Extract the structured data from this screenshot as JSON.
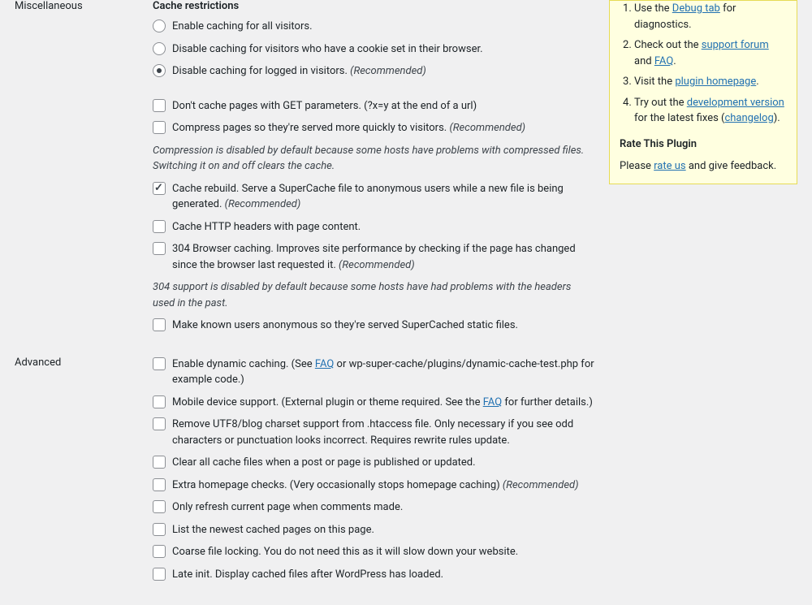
{
  "sections": {
    "misc": {
      "label": "Miscellaneous",
      "heading": "Cache restrictions",
      "radio1": "Enable caching for all visitors.",
      "radio2": "Disable caching for visitors who have a cookie set in their browser.",
      "radio3": "Disable caching for logged in visitors.",
      "recommended": "(Recommended)",
      "cb_get": "Don't cache pages with GET parameters. (?x=y at the end of a url)",
      "cb_compress": "Compress pages so they're served more quickly to visitors.",
      "note_compress": "Compression is disabled by default because some hosts have problems with compressed files. Switching it on and off clears the cache.",
      "cb_rebuild": "Cache rebuild. Serve a SuperCache file to anonymous users while a new file is being generated.",
      "cb_headers": "Cache HTTP headers with page content.",
      "cb_304": "304 Browser caching. Improves site performance by checking if the page has changed since the browser last requested it.",
      "note_304": "304 support is disabled by default because some hosts have had problems with the headers used in the past.",
      "cb_anon": "Make known users anonymous so they're served SuperCached static files."
    },
    "advanced": {
      "label": "Advanced",
      "cb_dynamic_pre": "Enable dynamic caching. (See ",
      "cb_dynamic_link": "FAQ",
      "cb_dynamic_post": " or wp-super-cache/plugins/dynamic-cache-test.php for example code.)",
      "cb_mobile_pre": "Mobile device support. (External plugin or theme required. See the ",
      "cb_mobile_link": "FAQ",
      "cb_mobile_post": " for further details.)",
      "cb_utf8": "Remove UTF8/blog charset support from .htaccess file. Only necessary if you see odd characters or punctuation looks incorrect. Requires rewrite rules update.",
      "cb_clear": "Clear all cache files when a post or page is published or updated.",
      "cb_homepage": "Extra homepage checks. (Very occasionally stops homepage caching)",
      "cb_refresh": "Only refresh current page when comments made.",
      "cb_newest": "List the newest cached pages on this page.",
      "cb_coarse": "Coarse file locking. You do not need this as it will slow down your website.",
      "cb_late": "Late init. Display cached files after WordPress has loaded."
    }
  },
  "sidebar": {
    "li1_pre": "Use the ",
    "li1_link": "Debug tab",
    "li1_post": " for diagnostics.",
    "li2_pre": "Check out the ",
    "li2_link1": "support forum",
    "li2_mid": " and ",
    "li2_link2": "FAQ",
    "li2_post": ".",
    "li3_pre": "Visit the ",
    "li3_link": "plugin homepage",
    "li3_post": ".",
    "li4_pre": "Try out the ",
    "li4_link1": "development version",
    "li4_mid": " for the latest fixes (",
    "li4_link2": "changelog",
    "li4_post": ").",
    "rate_heading": "Rate This Plugin",
    "rate_pre": "Please ",
    "rate_link": "rate us",
    "rate_post": " and give feedback."
  }
}
